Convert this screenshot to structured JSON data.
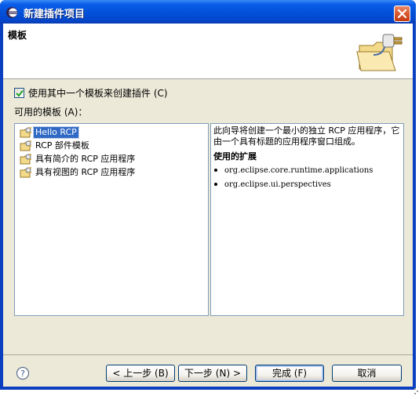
{
  "window": {
    "title": "新建插件项目"
  },
  "banner": {
    "title": "模板"
  },
  "options": {
    "use_template_label": "使用其中一个模板来创建插件 (C)",
    "use_template_checked": true,
    "available_label": "可用的模板 (A)："
  },
  "templates": [
    {
      "label": "Hello RCP",
      "selected": true
    },
    {
      "label": "RCP 部件模板",
      "selected": false
    },
    {
      "label": "具有简介的 RCP 应用程序",
      "selected": false
    },
    {
      "label": "具有视图的 RCP 应用程序",
      "selected": false
    }
  ],
  "description": {
    "text": "此向导将创建一个最小的独立 RCP 应用程序，它由一个具有标题的应用程序窗口组成。",
    "extensions_heading": "使用的扩展",
    "extensions": [
      "org.eclipse.core.runtime.applications",
      "org.eclipse.ui.perspectives"
    ]
  },
  "buttons": {
    "back": "< 上一步 (B)",
    "next": "下一步 (N) >",
    "finish": "完成 (F)",
    "cancel": "取消"
  },
  "icons": {
    "title": "eclipse-icon",
    "banner": "folder-plug-icon",
    "help": "help-icon",
    "template": "plugin-template-icon"
  }
}
